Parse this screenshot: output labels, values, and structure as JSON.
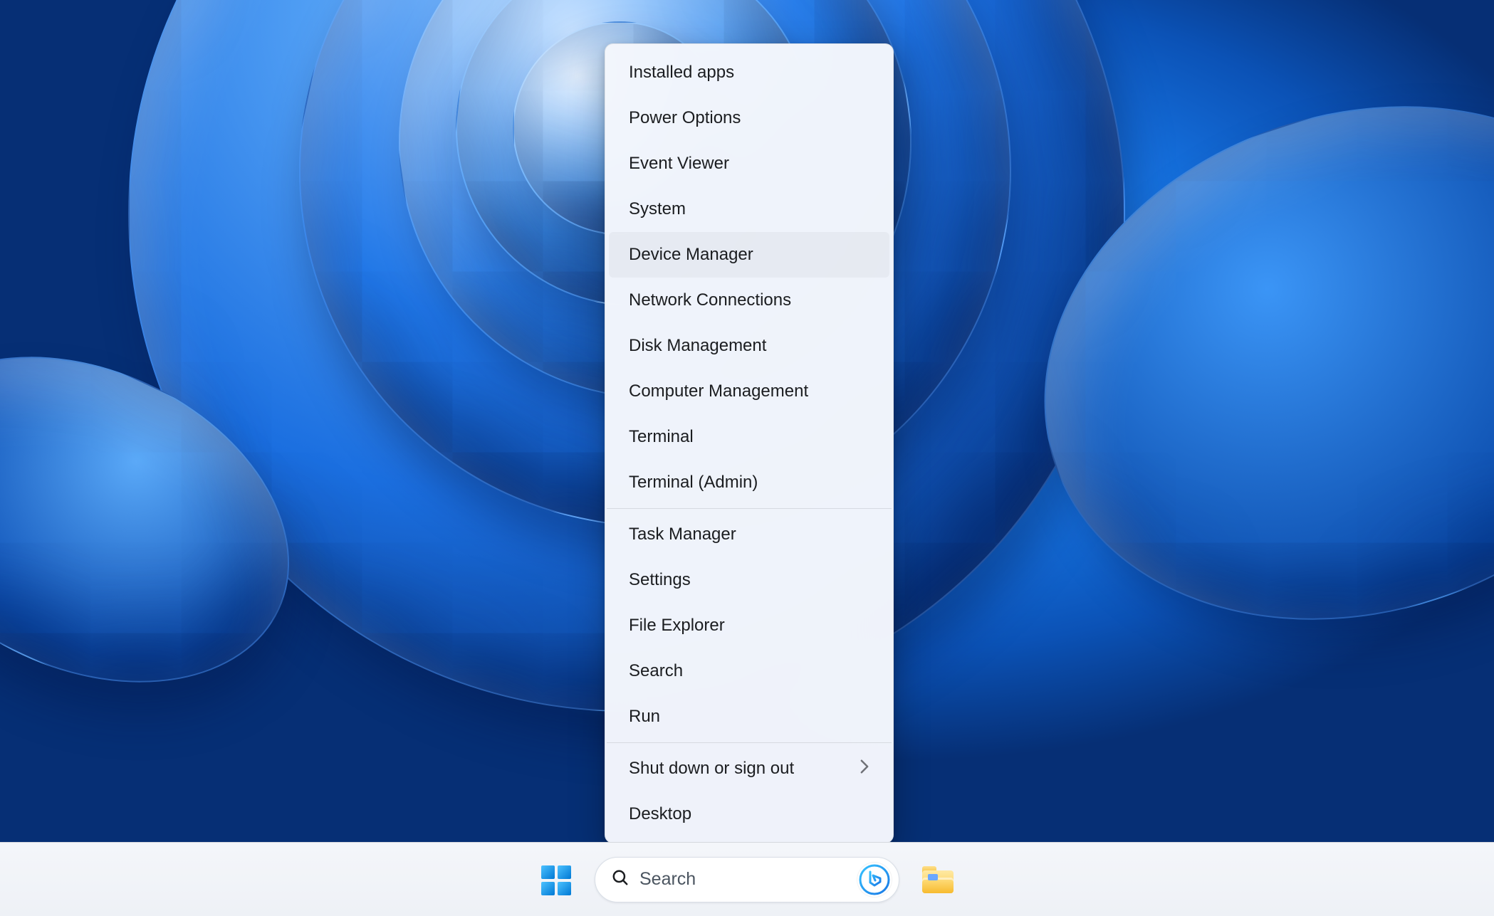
{
  "context_menu": {
    "groups": [
      [
        {
          "id": "installed-apps",
          "label": "Installed apps",
          "submenu": false,
          "highlight": false
        },
        {
          "id": "power-options",
          "label": "Power Options",
          "submenu": false,
          "highlight": false
        },
        {
          "id": "event-viewer",
          "label": "Event Viewer",
          "submenu": false,
          "highlight": false
        },
        {
          "id": "system",
          "label": "System",
          "submenu": false,
          "highlight": false
        },
        {
          "id": "device-manager",
          "label": "Device Manager",
          "submenu": false,
          "highlight": true
        },
        {
          "id": "network-connections",
          "label": "Network Connections",
          "submenu": false,
          "highlight": false
        },
        {
          "id": "disk-management",
          "label": "Disk Management",
          "submenu": false,
          "highlight": false
        },
        {
          "id": "computer-management",
          "label": "Computer Management",
          "submenu": false,
          "highlight": false
        },
        {
          "id": "terminal",
          "label": "Terminal",
          "submenu": false,
          "highlight": false
        },
        {
          "id": "terminal-admin",
          "label": "Terminal (Admin)",
          "submenu": false,
          "highlight": false
        }
      ],
      [
        {
          "id": "task-manager",
          "label": "Task Manager",
          "submenu": false,
          "highlight": false
        },
        {
          "id": "settings",
          "label": "Settings",
          "submenu": false,
          "highlight": false
        },
        {
          "id": "file-explorer",
          "label": "File Explorer",
          "submenu": false,
          "highlight": false
        },
        {
          "id": "search",
          "label": "Search",
          "submenu": false,
          "highlight": false
        },
        {
          "id": "run",
          "label": "Run",
          "submenu": false,
          "highlight": false
        }
      ],
      [
        {
          "id": "shut-down-or-sign-out",
          "label": "Shut down or sign out",
          "submenu": true,
          "highlight": false
        },
        {
          "id": "desktop",
          "label": "Desktop",
          "submenu": false,
          "highlight": false
        }
      ]
    ]
  },
  "taskbar": {
    "search_placeholder": "Search",
    "items": [
      {
        "id": "start",
        "icon": "windows-start-icon"
      },
      {
        "id": "search",
        "icon": "search-icon"
      },
      {
        "id": "file-explorer",
        "icon": "file-explorer-icon"
      }
    ]
  }
}
